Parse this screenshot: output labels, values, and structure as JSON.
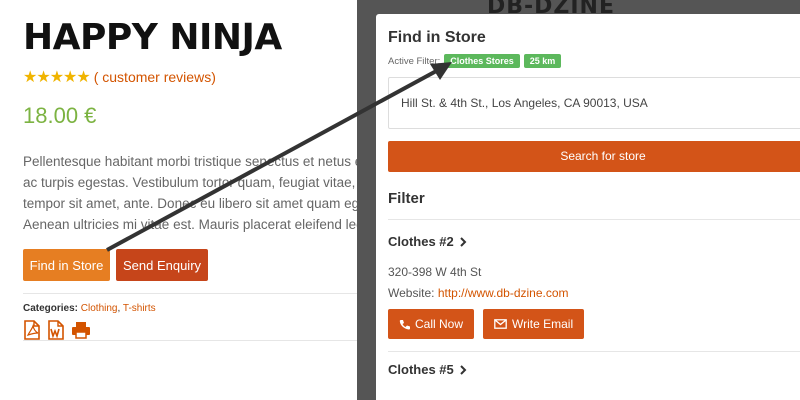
{
  "product": {
    "title": "HAPPY NINJA",
    "stars": "★★★★★",
    "reviews_link": "( customer reviews)",
    "price": "18.00 €",
    "description_lines": [
      "Pellentesque habitant morbi tristique senectus et netus e",
      "ac turpis egestas. Vestibulum tortor quam, feugiat vitae, u",
      "tempor sit amet, ante. Donec eu libero sit amet quam ege",
      "Aenean ultricies mi vitae est. Mauris placerat eleifend leo"
    ],
    "find_button": "Find in Store",
    "enquiry_button": "Send Enquiry",
    "categories_label": "Categories:",
    "categories": [
      "Clothing",
      "T-shirts"
    ],
    "doc_icons": [
      "pdf-icon",
      "word-icon",
      "print-icon"
    ]
  },
  "logo": {
    "text": "DB-DZINE"
  },
  "modal": {
    "title": "Find in Store",
    "active_filter_label": "Active Filter:",
    "filters": [
      "Clothes Stores",
      "25 km"
    ],
    "address": "Hill St. & 4th St., Los Angeles, CA 90013, USA",
    "search_button": "Search for store",
    "filter_heading": "Filter",
    "stores": [
      {
        "name": "Clothes #2",
        "address": "320-398 W 4th St",
        "website_label": "Website:",
        "website": "http://www.db-dzine.com",
        "call_button": "Call Now",
        "email_button": "Write Email"
      },
      {
        "name": "Clothes #5"
      }
    ]
  },
  "colors": {
    "accent": "#d35418",
    "find_button": "#e67e22",
    "price": "#7cb342",
    "tag": "#5cb85c",
    "stars": "#f0b400"
  }
}
